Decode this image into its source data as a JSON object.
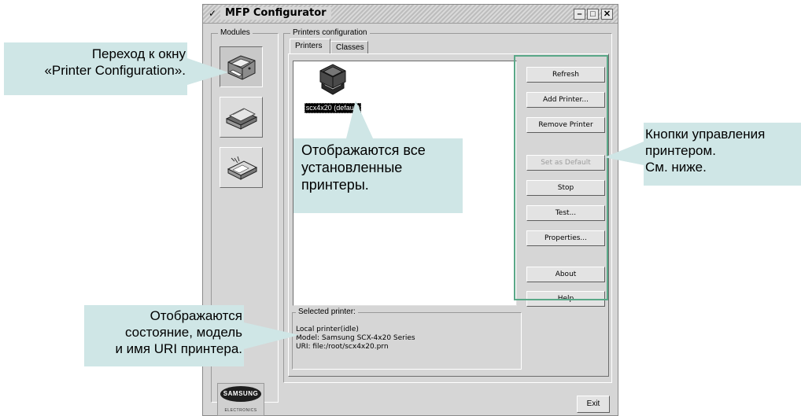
{
  "window": {
    "title": "MFP Configurator",
    "menu_icon": "chevron-down-icon",
    "controls": [
      "minimize-icon",
      "maximize-icon",
      "close-icon"
    ]
  },
  "modules": {
    "legend": "Modules",
    "items": [
      {
        "name": "printer-module",
        "icon": "printer-icon",
        "active": true
      },
      {
        "name": "scanner-module",
        "icon": "scanner-icon",
        "active": false
      },
      {
        "name": "port-module",
        "icon": "port-icon",
        "active": false
      }
    ],
    "logo_text": "SAMSUNG",
    "logo_sub": "ELECTRONICS"
  },
  "printers_config": {
    "legend": "Printers configuration",
    "tabs": [
      "Printers",
      "Classes"
    ],
    "printer": {
      "label": "scx4x20 (default)"
    },
    "buttons": [
      {
        "label": "Refresh",
        "enabled": true
      },
      {
        "label": "Add Printer...",
        "enabled": true
      },
      {
        "label": "Remove Printer",
        "enabled": true
      },
      {
        "label": "Set as Default",
        "enabled": false
      },
      {
        "label": "Stop",
        "enabled": true
      },
      {
        "label": "Test...",
        "enabled": true
      },
      {
        "label": "Properties...",
        "enabled": true
      },
      {
        "label": "About",
        "enabled": true
      },
      {
        "label": "Help",
        "enabled": true
      }
    ],
    "selected": {
      "legend": "Selected printer:",
      "lines": [
        "Local printer(idle)",
        "Model: Samsung SCX-4x20 Series",
        "URI: file:/root/scx4x20.prn"
      ]
    }
  },
  "exit_label": "Exit",
  "annotations": {
    "modules": [
      "Переход к окну",
      "«Printer Configuration»."
    ],
    "printers": [
      "Отображаются все",
      "установленные",
      "принтеры."
    ],
    "buttons": [
      "Кнопки управления",
      "принтером.",
      "См. ниже."
    ],
    "status": [
      "Отображаются",
      "состояние, модель",
      "и имя URI принтера."
    ]
  },
  "colors": {
    "callout_bg": "#cfe6e6",
    "highlight_frame": "#5aa888",
    "window_bg": "#d6d6d6"
  }
}
